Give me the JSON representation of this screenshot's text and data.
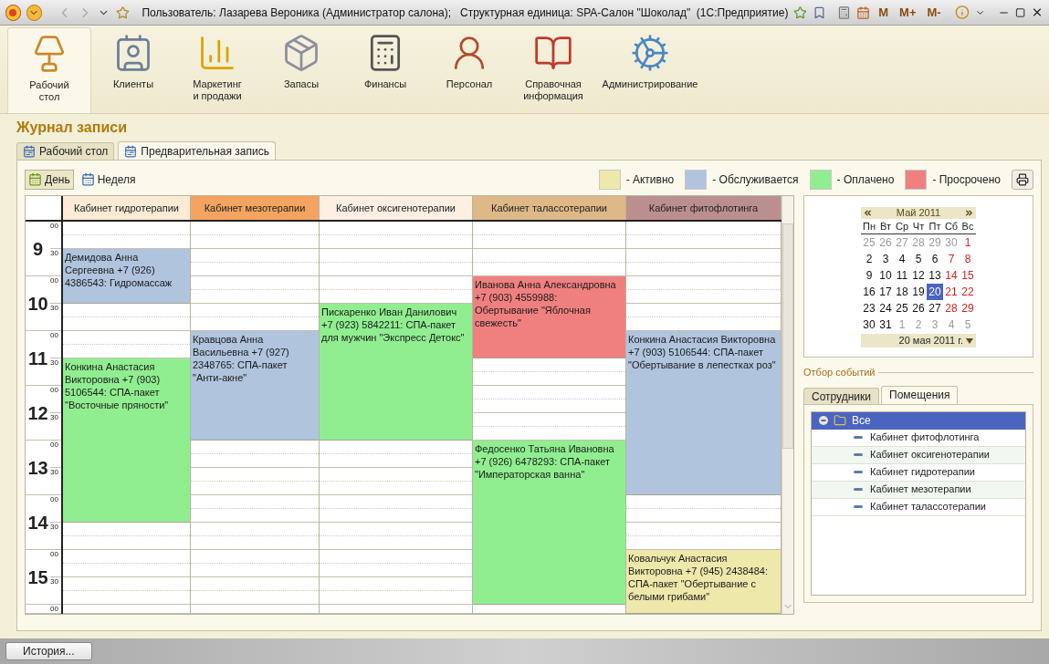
{
  "window": {
    "title": "Пользователь: Лазарева Вероника (Администратор салона);   Структурная единица: SPA-Салон \"Шоколад\"  (1С:Предприятие)",
    "memory_buttons": [
      "M",
      "M+",
      "M-"
    ]
  },
  "sections": [
    {
      "label": "Рабочий стол",
      "selected": true
    },
    {
      "label": "Клиенты",
      "selected": false
    },
    {
      "label": "Маркетинг и продажи",
      "selected": false
    },
    {
      "label": "Запасы",
      "selected": false
    },
    {
      "label": "Финансы",
      "selected": false
    },
    {
      "label": "Персонал",
      "selected": false
    },
    {
      "label": "Справочная информация",
      "selected": false
    },
    {
      "label": "Администрирование",
      "selected": false
    }
  ],
  "page_title": "Журнал записи",
  "tabs": [
    {
      "label": "Рабочий стол",
      "selected": false
    },
    {
      "label": "Предварительная запись",
      "selected": true
    }
  ],
  "view_buttons": [
    {
      "label": "День",
      "selected": true
    },
    {
      "label": "Неделя",
      "selected": false
    }
  ],
  "legend": [
    {
      "label": "- Активно",
      "color": "#eee8aa"
    },
    {
      "label": "- Обслуживается",
      "color": "#b0c4de"
    },
    {
      "label": "- Оплачено",
      "color": "#90ee90"
    },
    {
      "label": "- Просрочено",
      "color": "#f08080"
    }
  ],
  "schedule": {
    "time_rows": [
      {
        "label": "9",
        "minutes": [
          "00",
          "30"
        ]
      },
      {
        "label": "10",
        "minutes": [
          "00",
          "30"
        ]
      },
      {
        "label": "11",
        "minutes": [
          "00",
          "30"
        ]
      },
      {
        "label": "12",
        "minutes": [
          "00",
          "30"
        ]
      },
      {
        "label": "13",
        "minutes": [
          "00",
          "30"
        ]
      },
      {
        "label": "14",
        "minutes": [
          "00",
          "30"
        ]
      },
      {
        "label": "15",
        "minutes": [
          "00",
          "30"
        ]
      },
      {
        "minutes": [
          "00"
        ]
      }
    ],
    "columns": [
      {
        "title": "Кабинет гидротерапии",
        "color": "#fdebd5",
        "slots": [
          {
            "kind": "free"
          },
          {
            "kind": "event",
            "text": "Демидова Анна Сергеевна +7 (926) 4386543: Гидромассаж",
            "color": "#b0c4de"
          },
          {
            "kind": "continued"
          },
          {
            "kind": "free"
          },
          {
            "kind": "free"
          },
          {
            "kind": "event",
            "text": "Конкина Анастасия Викторовна +7 (903) 5106544: СПА-пакет \"Восточные пряности\"",
            "color": "#90ee90"
          },
          {
            "kind": "continued"
          },
          {
            "kind": "continued"
          },
          {
            "kind": "continued"
          },
          {
            "kind": "continued"
          },
          {
            "kind": "continued"
          },
          {
            "kind": "free"
          },
          {
            "kind": "free"
          },
          {
            "kind": "free"
          },
          {
            "kind": "free"
          }
        ]
      },
      {
        "title": "Кабинет мезотерапии",
        "color": "#f4a460",
        "slots": [
          {
            "kind": "free"
          },
          {
            "kind": "free"
          },
          {
            "kind": "free"
          },
          {
            "kind": "free"
          },
          {
            "kind": "event",
            "text": "Кравцова Анна Васильевна +7 (927) 2348765: СПА-пакет \"Анти-акне\"",
            "color": "#b0c4de"
          },
          {
            "kind": "continued"
          },
          {
            "kind": "continued"
          },
          {
            "kind": "continued"
          },
          {
            "kind": "free"
          },
          {
            "kind": "free"
          },
          {
            "kind": "free"
          },
          {
            "kind": "free"
          },
          {
            "kind": "free"
          },
          {
            "kind": "free"
          },
          {
            "kind": "free"
          }
        ]
      },
      {
        "title": "Кабинет оксигенотерапии",
        "color": "#fdf0e2",
        "slots": [
          {
            "kind": "free"
          },
          {
            "kind": "free"
          },
          {
            "kind": "free"
          },
          {
            "kind": "event",
            "text": "Пискаренко Иван Данилович +7 (923) 5842211: СПА-пакет для мужчин \"Экспресс Детокс\"",
            "color": "#90ee90"
          },
          {
            "kind": "continued"
          },
          {
            "kind": "continued"
          },
          {
            "kind": "continued"
          },
          {
            "kind": "continued"
          },
          {
            "kind": "free"
          },
          {
            "kind": "free"
          },
          {
            "kind": "free"
          },
          {
            "kind": "free"
          },
          {
            "kind": "free"
          },
          {
            "kind": "free"
          },
          {
            "kind": "free"
          }
        ]
      },
      {
        "title": "Кабинет талассотерапии",
        "color": "#deb887",
        "slots": [
          {
            "kind": "free"
          },
          {
            "kind": "free"
          },
          {
            "kind": "event",
            "text": "Иванова Анна Александровна +7 (903) 4559988: Обертывание \"Яблочная свежесть\"",
            "color": "#f08080"
          },
          {
            "kind": "continued"
          },
          {
            "kind": "continued"
          },
          {
            "kind": "free"
          },
          {
            "kind": "free"
          },
          {
            "kind": "free"
          },
          {
            "kind": "event",
            "text": "Федосенко Татьяна Ивановна +7 (926) 6478293: СПА-пакет \"Императорская ванна\"",
            "color": "#90ee90"
          },
          {
            "kind": "continued"
          },
          {
            "kind": "continued"
          },
          {
            "kind": "continued"
          },
          {
            "kind": "continued"
          },
          {
            "kind": "continued"
          },
          {
            "kind": "free"
          }
        ]
      },
      {
        "title": "Кабинет фитофлотинга",
        "color": "#bc8f8f",
        "slots": [
          {
            "kind": "free"
          },
          {
            "kind": "free"
          },
          {
            "kind": "free"
          },
          {
            "kind": "free"
          },
          {
            "kind": "event",
            "text": "Конкина Анастасия Викторовна +7 (903) 5106544: СПА-пакет \"Обертывание в лепестках роз\"",
            "color": "#b0c4de"
          },
          {
            "kind": "continued"
          },
          {
            "kind": "continued"
          },
          {
            "kind": "continued"
          },
          {
            "kind": "continued"
          },
          {
            "kind": "continued"
          },
          {
            "kind": "free"
          },
          {
            "kind": "free"
          },
          {
            "kind": "event",
            "text": "Ковальчук Анастасия Викторовна +7 (945) 2438484: СПА-пакет \"Обертывание с белыми грибами\"",
            "color": "#eee8aa"
          },
          {
            "kind": "continued"
          },
          {
            "kind": "continued"
          }
        ]
      }
    ]
  },
  "calendar": {
    "month": "Май 2011",
    "weekdays": [
      "Пн",
      "Вт",
      "Ср",
      "Чт",
      "Пт",
      "Сб",
      "Вс"
    ],
    "weeks": [
      [
        {
          "d": "25",
          "kind": "other",
          "selected": false
        },
        {
          "d": "26",
          "kind": "other",
          "selected": false
        },
        {
          "d": "27",
          "kind": "other",
          "selected": false
        },
        {
          "d": "28",
          "kind": "other",
          "selected": false
        },
        {
          "d": "29",
          "kind": "other",
          "selected": false
        },
        {
          "d": "30",
          "kind": "other",
          "selected": false
        },
        {
          "d": "1",
          "kind": "weekend",
          "selected": false
        }
      ],
      [
        {
          "d": "2",
          "kind": "work",
          "selected": false
        },
        {
          "d": "3",
          "kind": "work",
          "selected": false
        },
        {
          "d": "4",
          "kind": "work",
          "selected": false
        },
        {
          "d": "5",
          "kind": "work",
          "selected": false
        },
        {
          "d": "6",
          "kind": "work",
          "selected": false
        },
        {
          "d": "7",
          "kind": "weekend",
          "selected": false
        },
        {
          "d": "8",
          "kind": "weekend",
          "selected": false
        }
      ],
      [
        {
          "d": "9",
          "kind": "work",
          "selected": false
        },
        {
          "d": "10",
          "kind": "work",
          "selected": false
        },
        {
          "d": "11",
          "kind": "work",
          "selected": false
        },
        {
          "d": "12",
          "kind": "work",
          "selected": false
        },
        {
          "d": "13",
          "kind": "work",
          "selected": false
        },
        {
          "d": "14",
          "kind": "weekend",
          "selected": false
        },
        {
          "d": "15",
          "kind": "weekend",
          "selected": false
        }
      ],
      [
        {
          "d": "16",
          "kind": "work",
          "selected": false
        },
        {
          "d": "17",
          "kind": "work",
          "selected": false
        },
        {
          "d": "18",
          "kind": "work",
          "selected": false
        },
        {
          "d": "19",
          "kind": "work",
          "selected": false
        },
        {
          "d": "20",
          "kind": "work",
          "selected": true
        },
        {
          "d": "21",
          "kind": "weekend",
          "selected": false
        },
        {
          "d": "22",
          "kind": "weekend",
          "selected": false
        }
      ],
      [
        {
          "d": "23",
          "kind": "work",
          "selected": false
        },
        {
          "d": "24",
          "kind": "work",
          "selected": false
        },
        {
          "d": "25",
          "kind": "work",
          "selected": false
        },
        {
          "d": "26",
          "kind": "work",
          "selected": false
        },
        {
          "d": "27",
          "kind": "work",
          "selected": false
        },
        {
          "d": "28",
          "kind": "weekend",
          "selected": false
        },
        {
          "d": "29",
          "kind": "weekend",
          "selected": false
        }
      ],
      [
        {
          "d": "30",
          "kind": "work",
          "selected": false
        },
        {
          "d": "31",
          "kind": "work",
          "selected": false
        },
        {
          "d": "1",
          "kind": "other",
          "selected": false
        },
        {
          "d": "2",
          "kind": "other",
          "selected": false
        },
        {
          "d": "3",
          "kind": "other",
          "selected": false
        },
        {
          "d": "4",
          "kind": "other",
          "selected": false
        },
        {
          "d": "5",
          "kind": "other",
          "selected": false
        }
      ]
    ],
    "date": "20 мая 2011 г."
  },
  "filter": {
    "title": "Отбор событий",
    "tabs": [
      {
        "label": "Сотрудники",
        "selected": false
      },
      {
        "label": "Помещения",
        "selected": true
      }
    ],
    "tree": [
      {
        "label": "Все",
        "expanded": true,
        "selected": true,
        "children": [
          {
            "label": "Кабинет фитофлотинга",
            "selected": false
          },
          {
            "label": "Кабинет оксигенотерапии",
            "selected": false
          },
          {
            "label": "Кабинет гидротерапии",
            "selected": false
          },
          {
            "label": "Кабинет мезотерапии",
            "selected": false
          },
          {
            "label": "Кабинет талассотерапии",
            "selected": false
          }
        ]
      }
    ]
  },
  "footer": {
    "button": "История..."
  }
}
